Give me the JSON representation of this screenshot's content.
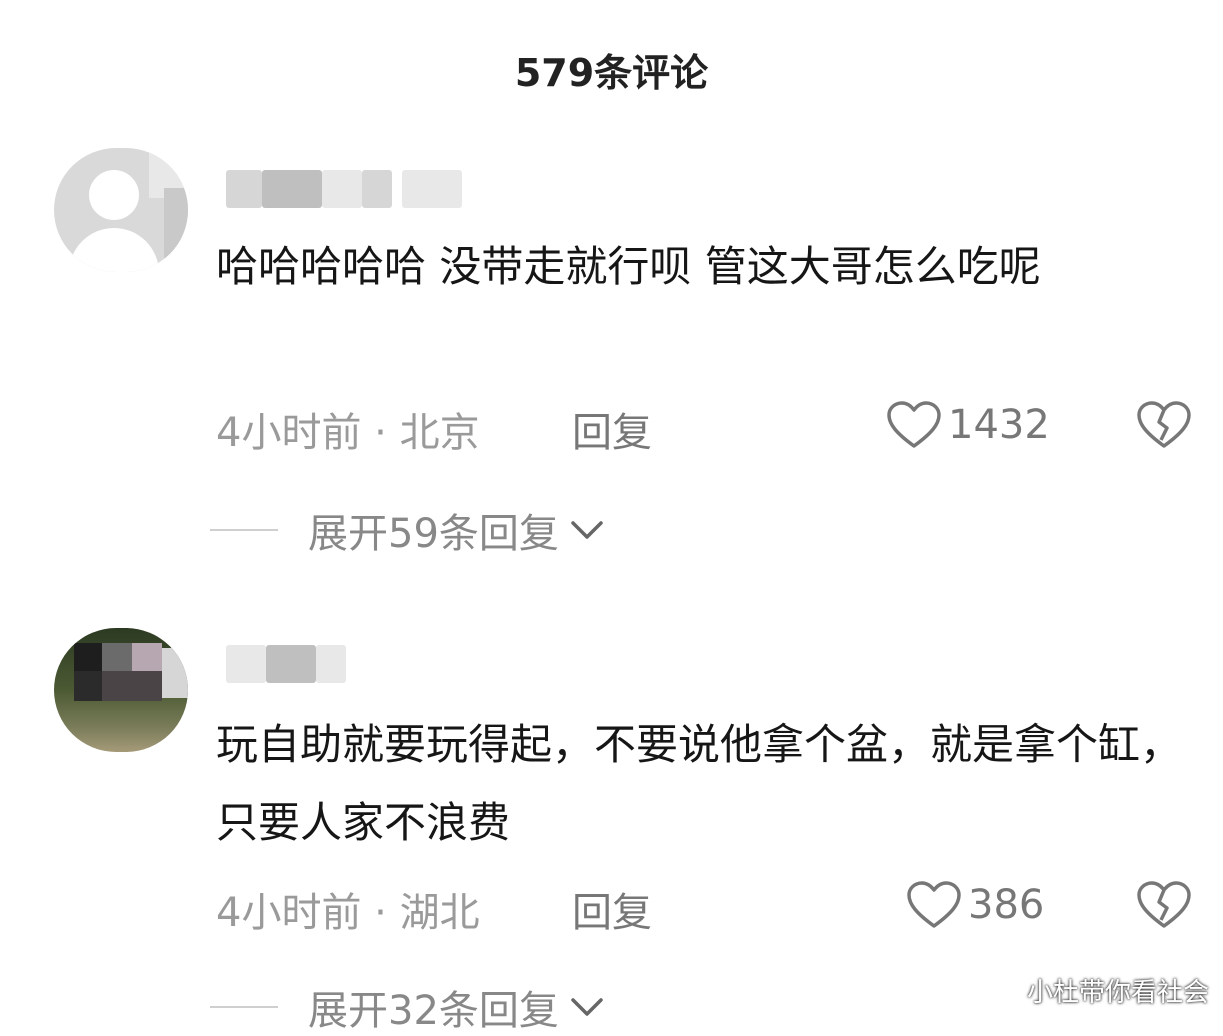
{
  "header": {
    "title": "579条评论"
  },
  "comments": [
    {
      "text": "哈哈哈哈哈 没带走就行呗 管这大哥怎么吃呢",
      "time_location": "4小时前 · 北京",
      "reply_label": "回复",
      "likes": "1432",
      "expand_label": "展开59条回复"
    },
    {
      "text": "玩自助就要玩得起，不要说他拿个盆，就是拿个缸，只要人家不浪费",
      "time_location": "4小时前 · 湖北",
      "reply_label": "回复",
      "likes": "386",
      "expand_label": "展开32条回复"
    }
  ],
  "watermark": "小杜带你看社会",
  "icons": [
    "heart-icon",
    "broken-heart-icon",
    "chevron-down-icon",
    "avatar-placeholder-icon"
  ]
}
